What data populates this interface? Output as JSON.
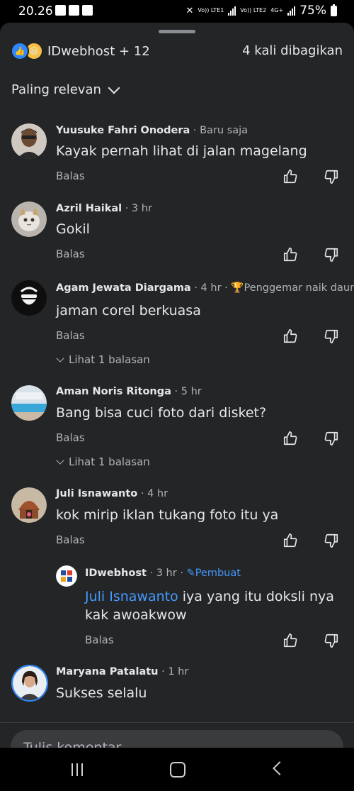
{
  "status_bar": {
    "time": "20.26",
    "battery": "75%",
    "sim1": "Vo)) LTE1",
    "sim2": "Vo)) LTE2",
    "network": "4G+"
  },
  "header": {
    "reaction_summary": "IDwebhost + 12",
    "shares": "4 kali dibagikan"
  },
  "sort": {
    "label": "Paling relevan"
  },
  "comments": [
    {
      "name": "Yuusuke Fahri Onodera",
      "time": "· Baru saja",
      "text": "Kayak pernah lihat di jalan magelang",
      "reply": "Balas"
    },
    {
      "name": "Azril Haikal",
      "time": "· 3 hr",
      "text": "Gokil",
      "reply": "Balas"
    },
    {
      "name": "Agam Jewata Diargama",
      "time": "· 4 hr ·",
      "badge": "Penggemar naik daun",
      "text": "jaman corel berkuasa",
      "reply": "Balas",
      "view_replies": "Lihat 1 balasan"
    },
    {
      "name": "Aman Noris Ritonga",
      "time": "· 5 hr",
      "text": "Bang bisa cuci foto dari disket?",
      "reply": "Balas",
      "view_replies": "Lihat 1 balasan"
    },
    {
      "name": "Juli Isnawanto",
      "time": "· 4 hr",
      "text": "kok mirip iklan tukang foto itu ya",
      "reply": "Balas"
    },
    {
      "name": "Maryana Patalatu",
      "time": "· 1 hr",
      "text": "Sukses selalu"
    }
  ],
  "nested_reply": {
    "name": "IDwebhost",
    "time": "· 3 hr ·",
    "badge": "Pembuat",
    "mention": "Juli Isnawanto",
    "text_line1": " iya yang itu doksli nya",
    "text_line2": "kak awoakwow",
    "reply": "Balas"
  },
  "composer": {
    "placeholder": "Tulis komentar..."
  },
  "colors": {
    "accent": "#2d88ff",
    "link": "#4599ff",
    "sheet": "#242526"
  }
}
